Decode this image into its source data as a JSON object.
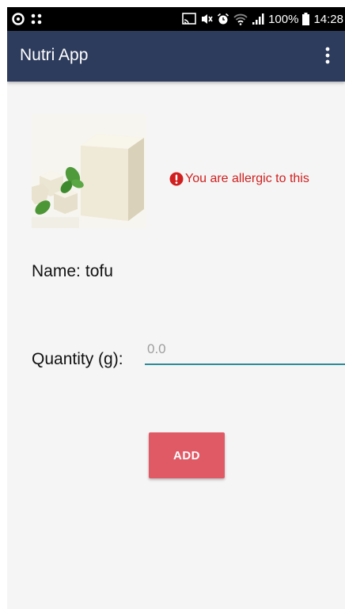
{
  "status_bar": {
    "battery_percent": "100%",
    "time": "14:28",
    "icons": [
      "sync-icon",
      "app-grid-icon",
      "cast-icon",
      "mute-icon",
      "alarm-icon",
      "wifi-icon",
      "signal-icon",
      "battery-icon"
    ]
  },
  "app_bar": {
    "title": "Nutri App",
    "menu_icon": "more-vert-icon",
    "color": "#2d3b5c"
  },
  "food": {
    "image_icon": "tofu-photo",
    "allergy_warning": "You are allergic to this",
    "warning_icon": "error-icon",
    "warning_color": "#d11f1f",
    "name_label": "Name:",
    "name_value": "tofu"
  },
  "quantity": {
    "label": "Quantity (g):",
    "placeholder": "0.0",
    "value": "",
    "underline_color": "#2b8a99"
  },
  "add_button": {
    "label": "ADD",
    "color": "#e05a66"
  }
}
